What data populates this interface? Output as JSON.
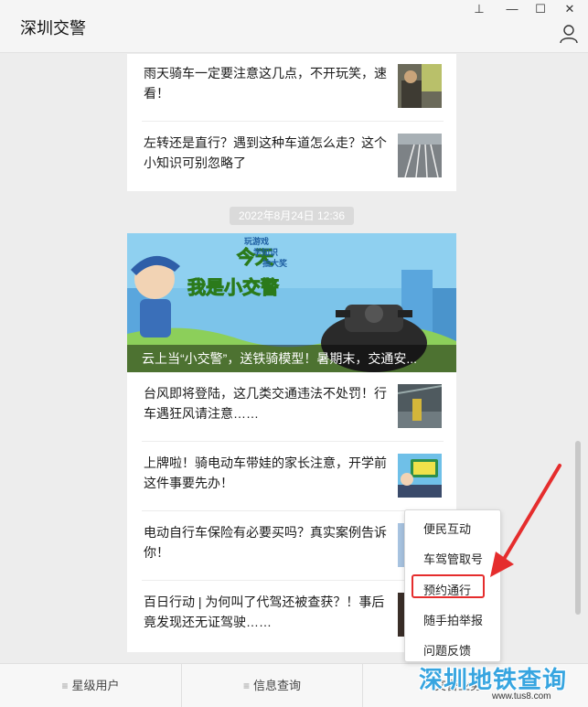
{
  "window": {
    "title": "深圳交警",
    "controls": {
      "pin": "⊥",
      "minimize": "—",
      "maximize": "☐",
      "close": "✕"
    }
  },
  "feed": {
    "card1": {
      "articles": [
        {
          "title": "雨天骑车一定要注意这几点，不开玩笑，速看！"
        },
        {
          "title": "左转还是直行？遇到这种车道怎么走？这个小知识可别忽略了"
        }
      ]
    },
    "timestamp": "2022年8月24日  12:36",
    "card2": {
      "cover_caption": "云上当“小交警”，送铁骑模型！暑期末，交通安...",
      "cover_texts": {
        "headline_1": "今天",
        "headline_2": "我是小交警",
        "tag_1": "玩游戏",
        "tag_2": "学知识",
        "tag_3": "抽大奖"
      },
      "articles": [
        {
          "title": "台风即将登陆，这几类交通违法不处罚！行车遇狂风请注意……"
        },
        {
          "title": "上牌啦！骑电动车带娃的家长注意，开学前这件事要先办！"
        },
        {
          "title": "电动自行车保险有必要买吗？真实案例告诉你！"
        },
        {
          "title": "百日行动 | 为何叫了代驾还被查获？！事后竟发现还无证驾驶……"
        }
      ]
    }
  },
  "bottom_menu": {
    "tabs": [
      {
        "label": "星级用户"
      },
      {
        "label": "信息查询"
      },
      {
        "label": "交警业务"
      }
    ]
  },
  "popup_menu": {
    "items": [
      {
        "label": "便民互动"
      },
      {
        "label": "车驾管取号"
      },
      {
        "label": "预约通行"
      },
      {
        "label": "随手拍举报"
      },
      {
        "label": "问题反馈"
      }
    ],
    "highlighted_item": "预约通行"
  },
  "watermark": {
    "main": "深圳地铁查询",
    "sub": "www.tus8.com"
  },
  "colors": {
    "highlight": "#e52d2d",
    "arrow": "#e52d2d",
    "watermark": "#37a5e0"
  }
}
